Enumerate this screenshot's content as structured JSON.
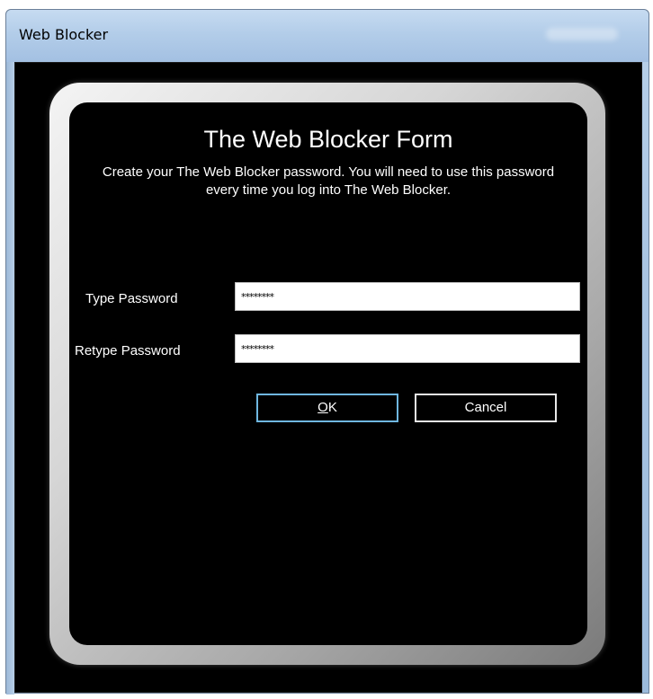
{
  "window": {
    "title": "Web Blocker"
  },
  "form": {
    "title": "The Web Blocker Form",
    "description": "Create your The Web Blocker password. You will need to use this password every time you log into The Web Blocker.",
    "type_password_label": "Type Password",
    "type_password_value": "********",
    "retype_password_label": "Retype Password",
    "retype_password_value": "********",
    "ok_label": "OK",
    "cancel_label": "Cancel"
  },
  "colors": {
    "background": "#000000",
    "text": "#ffffff",
    "ok_border": "#6fb7e0",
    "titlebar": "#b3cde9"
  }
}
